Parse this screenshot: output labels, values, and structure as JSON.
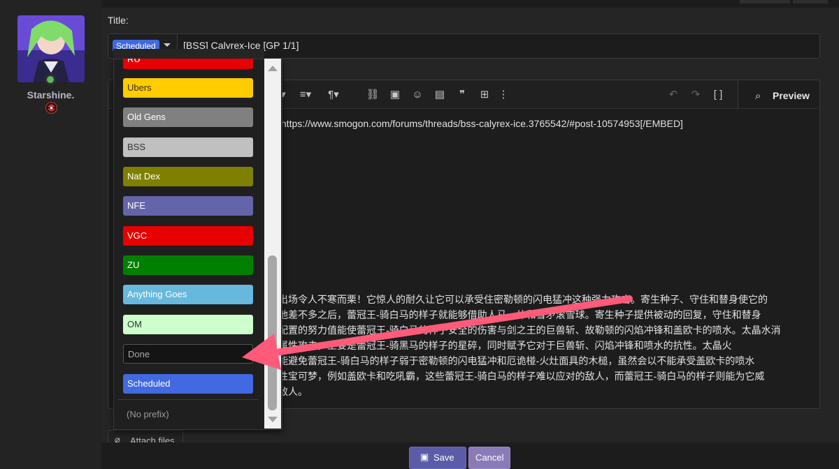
{
  "user": {
    "name": "Starshine.",
    "avatar_icon": "avatar-anime-character",
    "badge_icon": "pokeball-badge-icon"
  },
  "form": {
    "title_label": "Title:",
    "prefix_selected": "Scheduled",
    "title_value": "[BSS] Calyrex-Ice [GP 1/1]"
  },
  "toolbar": {
    "preview_label": "Preview"
  },
  "editor": {
    "lines": [
      "]https://www.smogon.com/forums/threads/bss-calyrex-ice.3765542/#post-10574953[/EMBED]",
      "出场令人不寒而栗！它惊人的耐久让它可以承受住密勒顿的闪电猛冲这种强力攻击。寄生种子、守住和替身使它的",
      "地差不多之后，蕾冠王-骑白马的样子就能够借助人马一体和雪矛滚雪球。寄生种子提供被动的回复，守住和替身",
      "配置的努力值能使蕾冠王-骑白马的样子安全的伤害与剑之王的巨兽斩、故勒顿的闪焰冲锋和盖欧卡的喷水。太晶水消",
      "属性攻击，主要是蕾冠王-骑黑马的样子的星碎，同时赋予它对于巨兽斩、闪焰冲锋和喷水的抗性。太晶火",
      "能避免蕾冠王-骑白马的样子弱于密勒顿的闪电猛冲和厄诡椪-火灶面具的木槌，虽然会以不能承受盖欧卡的喷水",
      "性宝可梦，例如盖欧卡和吃吼霸，这些蕾冠王-骑白马的样子难以应对的敌人，而蕾冠王-骑白马的样子则能为它威",
      "敌人。"
    ]
  },
  "dropdown": {
    "options": [
      {
        "label": "RU",
        "bg": "#e60000",
        "fg": "#ffffff"
      },
      {
        "label": "Ubers",
        "bg": "#ffcc00",
        "fg": "#333333"
      },
      {
        "label": "Old Gens",
        "bg": "#808080",
        "fg": "#ffffff"
      },
      {
        "label": "BSS",
        "bg": "#c0c0c0",
        "fg": "#333333"
      },
      {
        "label": "Nat Dex",
        "bg": "#808000",
        "fg": "#ffffff"
      },
      {
        "label": "NFE",
        "bg": "#6464aa",
        "fg": "#ffffff"
      },
      {
        "label": "VGC",
        "bg": "#e60000",
        "fg": "#ffffff"
      },
      {
        "label": "ZU",
        "bg": "#008000",
        "fg": "#ffffff"
      },
      {
        "label": "Anything Goes",
        "bg": "#66b8dc",
        "fg": "#ffffff"
      },
      {
        "label": "OM",
        "bg": "#ccffcc",
        "fg": "#333333"
      },
      {
        "label": "Done",
        "bg": "#141414",
        "fg": "#aaaaaa"
      },
      {
        "label": "Scheduled",
        "bg": "#4169e1",
        "fg": "#ffffff"
      }
    ],
    "no_prefix_label": "(No prefix)"
  },
  "actions": {
    "attach_label": "Attach files",
    "save_label": "Save",
    "cancel_label": "Cancel"
  },
  "annotation": {
    "arrow_color": "#ff5a7a"
  }
}
